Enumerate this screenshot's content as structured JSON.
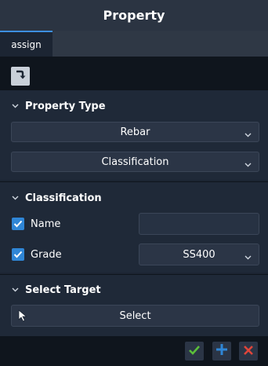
{
  "window": {
    "title": "Property"
  },
  "tabs": [
    {
      "label": "assign",
      "active": true
    }
  ],
  "toolbar": {
    "icon": "turn-down-arrow-icon"
  },
  "property_type": {
    "title": "Property Type",
    "dropdown1": {
      "value": "Rebar"
    },
    "dropdown2": {
      "value": "Classification"
    }
  },
  "classification": {
    "title": "Classification",
    "name": {
      "label": "Name",
      "checked": true,
      "value": ""
    },
    "grade": {
      "label": "Grade",
      "checked": true,
      "value": "SS400"
    }
  },
  "select_target": {
    "title": "Select Target",
    "button_label": "Select"
  },
  "footer": {
    "buttons": [
      "confirm-check-icon",
      "add-plus-icon",
      "cancel-x-icon"
    ]
  },
  "colors": {
    "accent": "#2f86d6",
    "confirm": "#5bbf3a",
    "add": "#2f86d6",
    "cancel": "#e0453a"
  }
}
